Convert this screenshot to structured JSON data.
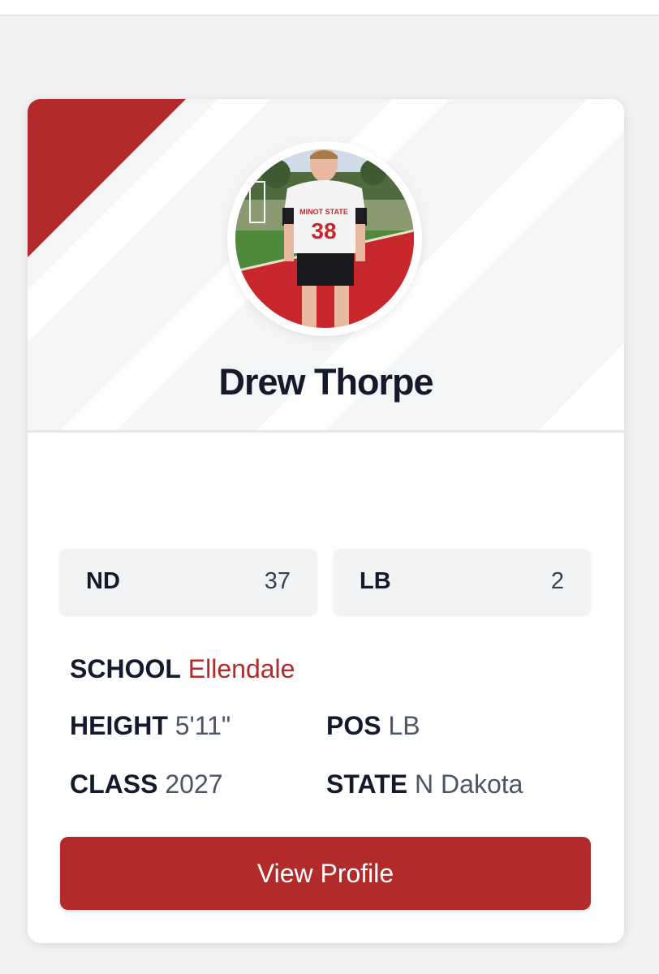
{
  "player": {
    "name": "Drew Thorpe"
  },
  "rankings": [
    {
      "label": "ND",
      "value": "37"
    },
    {
      "label": "LB",
      "value": "2"
    }
  ],
  "details": {
    "school": {
      "label": "SCHOOL",
      "value": "Ellendale"
    },
    "height": {
      "label": "HEIGHT",
      "value": "5'11\""
    },
    "pos": {
      "label": "POS",
      "value": "LB"
    },
    "class": {
      "label": "CLASS",
      "value": "2027"
    },
    "state": {
      "label": "STATE",
      "value": "N Dakota"
    }
  },
  "actions": {
    "view_profile_label": "View Profile"
  },
  "colors": {
    "accent": "#b32a2a",
    "text_dark": "#141a2b",
    "page_bg": "#f1f2f4"
  }
}
